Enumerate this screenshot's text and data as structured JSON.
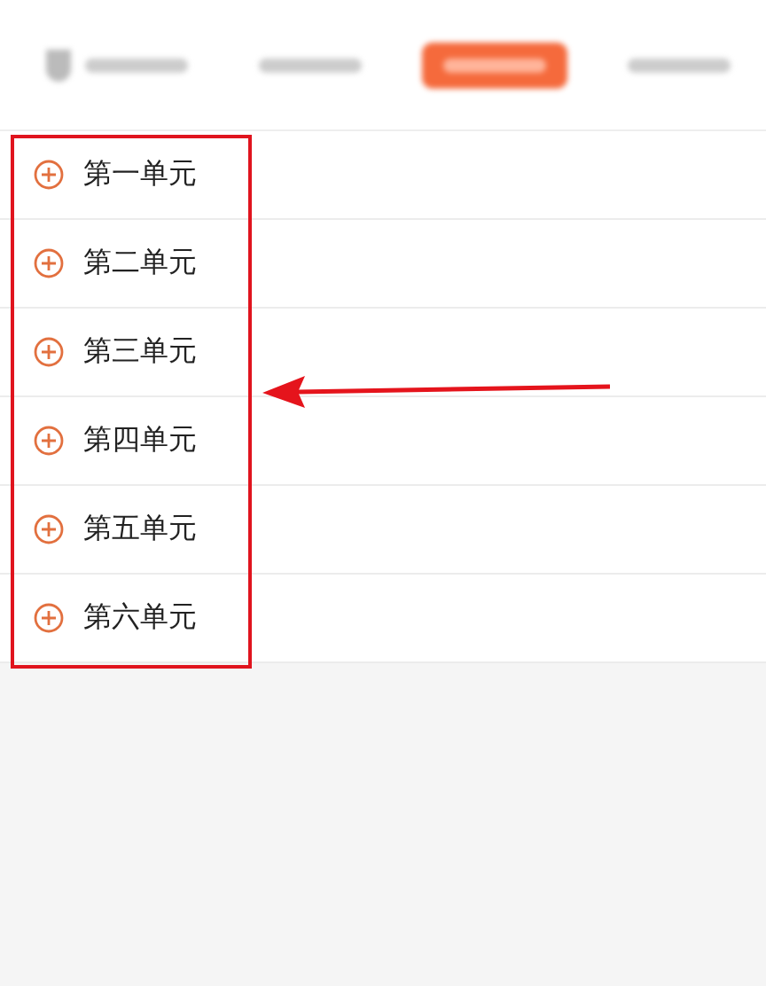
{
  "tabs": [
    {
      "selected": false,
      "has_icon": true
    },
    {
      "selected": false,
      "has_icon": false
    },
    {
      "selected": true,
      "has_icon": false
    },
    {
      "selected": false,
      "has_icon": false
    }
  ],
  "units": [
    {
      "label": "第一单元"
    },
    {
      "label": "第二单元"
    },
    {
      "label": "第三单元"
    },
    {
      "label": "第四单元"
    },
    {
      "label": "第五单元"
    },
    {
      "label": "第六单元"
    }
  ],
  "annotation": {
    "kind": "highlight-arrow"
  }
}
